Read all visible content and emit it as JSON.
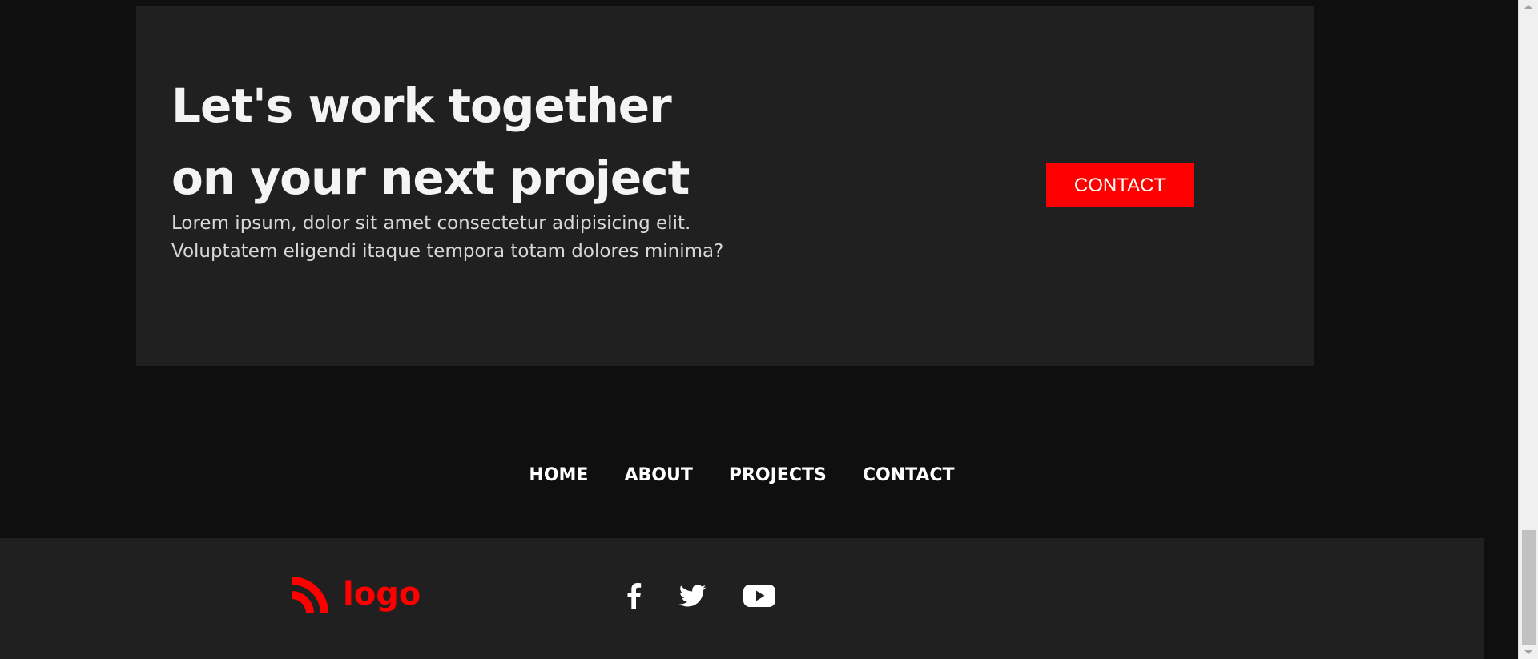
{
  "cta": {
    "title": "Let's work together on your next project",
    "text": "Lorem ipsum, dolor sit amet consectetur adipisicing elit. Voluptatem eligendi itaque tempora totam dolores minima?",
    "button_label": "CONTACT"
  },
  "nav": {
    "items": [
      {
        "label": "HOME"
      },
      {
        "label": "ABOUT"
      },
      {
        "label": "PROJECTS"
      },
      {
        "label": "CONTACT"
      }
    ]
  },
  "footer": {
    "logo_text": "logo",
    "logo_icon": "rss-icon",
    "socials": [
      {
        "icon": "facebook-icon"
      },
      {
        "icon": "twitter-icon"
      },
      {
        "icon": "youtube-icon"
      }
    ]
  },
  "colors": {
    "accent": "#ff0000",
    "background": "#0f0f0f",
    "card": "#202020",
    "text": "#ffffff"
  }
}
